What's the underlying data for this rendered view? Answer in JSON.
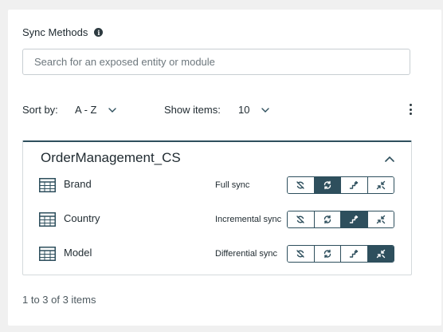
{
  "panel": {
    "title": "Sync Methods",
    "info_icon": "i"
  },
  "search": {
    "placeholder": "Search for an exposed entity or module",
    "value": ""
  },
  "controls": {
    "sort_label": "Sort by:",
    "sort_value": "A - Z",
    "show_label": "Show items:",
    "show_value": "10"
  },
  "group": {
    "title": "OrderManagement_CS",
    "rows": [
      {
        "name": "Brand",
        "sync": "Full sync",
        "active": 1
      },
      {
        "name": "Country",
        "sync": "Incremental sync",
        "active": 2
      },
      {
        "name": "Model",
        "sync": "Differential sync",
        "active": 3
      }
    ]
  },
  "sync_modes": [
    "no-sync-icon",
    "full-sync-icon",
    "incremental-sync-icon",
    "differential-sync-icon"
  ],
  "colors": {
    "accent": "#2e4f5d",
    "border": "#d4d9dc"
  },
  "footer": {
    "summary": "1 to 3 of 3 items"
  }
}
